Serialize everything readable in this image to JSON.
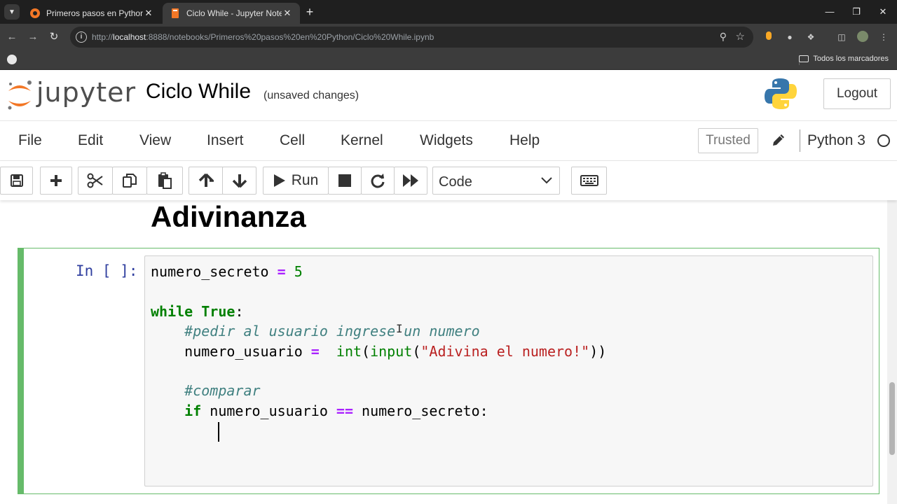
{
  "browser": {
    "tabs": [
      {
        "label": "Primeros pasos en Python/",
        "active": false
      },
      {
        "label": "Ciclo While - Jupyter Notebook",
        "active": true
      }
    ],
    "url_scheme_path": "http://",
    "url_host": "localhost",
    "url_rest": ":8888/notebooks/Primeros%20pasos%20en%20Python/Ciclo%20While.ipynb",
    "bookmarks_label": "Todos los marcadores"
  },
  "header": {
    "logo_text": "jupyter",
    "notebook_title": "Ciclo While",
    "autosave_status": "(unsaved changes)",
    "logout_label": "Logout"
  },
  "menubar": {
    "items": [
      "File",
      "Edit",
      "View",
      "Insert",
      "Cell",
      "Kernel",
      "Widgets",
      "Help"
    ],
    "trusted_label": "Trusted",
    "kernel_name": "Python 3"
  },
  "toolbar": {
    "run_label": "Run",
    "cell_type": "Code"
  },
  "notebook": {
    "markdown_heading": "Adivinanza",
    "cell_prompt": "In [ ]:",
    "code_lines": [
      "numero_secreto = 5",
      "",
      "while True:",
      "    #pedir al usuario ingrese un numero",
      "    numero_usuario =  int(input(\"Adivina el numero!\"))",
      "",
      "    #comparar",
      "    if numero_usuario == numero_secreto:",
      "        "
    ]
  },
  "colors": {
    "cell_border": "#66bb6a",
    "prompt": "#303f9f",
    "keyword": "#008000",
    "operator": "#aa22ff",
    "string": "#ba2121",
    "comment": "#408080"
  }
}
